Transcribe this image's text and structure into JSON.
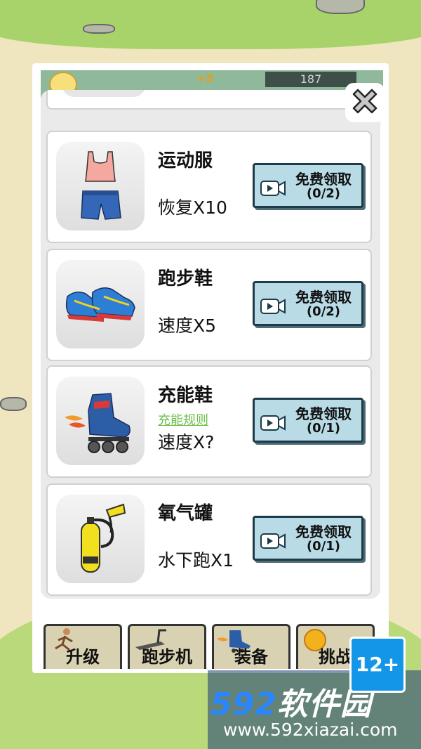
{
  "header": {
    "bonus_text": "+5",
    "coin_count": "187"
  },
  "items": [
    {
      "name": "运动服",
      "effect": "恢复X10",
      "rule_link": null,
      "button_label": "免费领取",
      "button_count": "(0/2)",
      "icon": "sportswear-icon"
    },
    {
      "name": "跑步鞋",
      "effect": "速度X5",
      "rule_link": null,
      "button_label": "免费领取",
      "button_count": "(0/2)",
      "icon": "running-shoe-icon"
    },
    {
      "name": "充能鞋",
      "effect": "速度X?",
      "rule_link": "充能规则",
      "button_label": "免费领取",
      "button_count": "(0/1)",
      "icon": "rocket-skate-icon"
    },
    {
      "name": "氧气罐",
      "effect": "水下跑X1",
      "rule_link": null,
      "button_label": "免费领取",
      "button_count": "(0/1)",
      "icon": "oxygen-tank-icon"
    }
  ],
  "toolbar": {
    "tabs": [
      "升级",
      "跑步机",
      "装备",
      "挑战"
    ]
  },
  "watermark": {
    "brand_num": "592",
    "brand_text": "软件园",
    "url": "www.592xiazai.com",
    "age_rating": "12+"
  },
  "colors": {
    "button_bg": "#b9dbe6",
    "button_border": "#1d3b4a",
    "link_green": "#6abf4a",
    "card_bg": "#ffffff",
    "panel_bg": "#eaeaea"
  }
}
